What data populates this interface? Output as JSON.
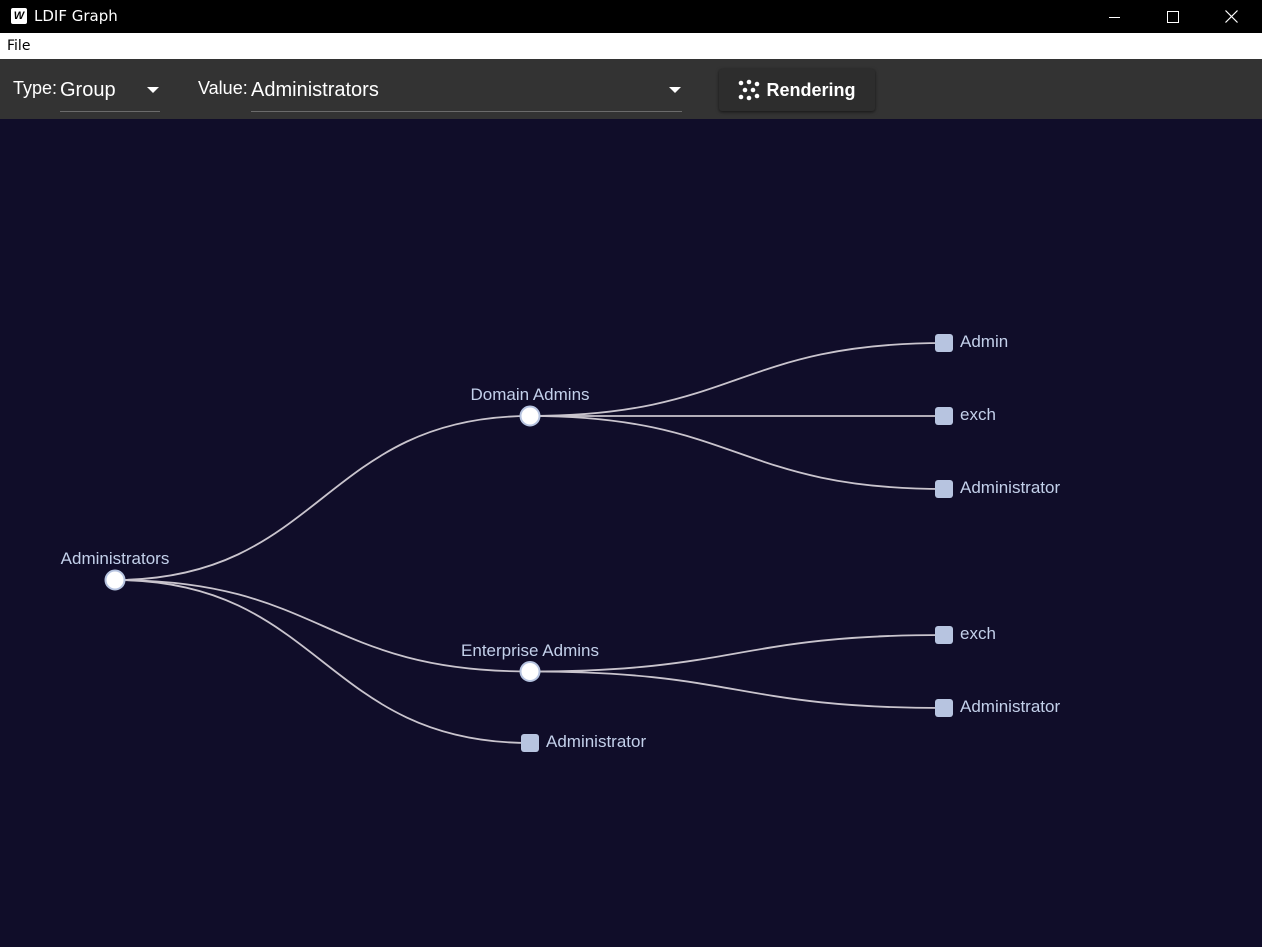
{
  "window": {
    "app_icon_letter": "W",
    "title": "LDIF Graph",
    "controls": [
      "minimize-icon",
      "maximize-icon",
      "close-icon"
    ]
  },
  "menu": {
    "file_label": "File"
  },
  "toolbar": {
    "type_label": "Type:",
    "type_value": "Group",
    "value_label": "Value:",
    "value_value": "Administrators",
    "render_label": "Rendering",
    "render_icon": "graph-nodes-icon"
  },
  "graph": {
    "colors": {
      "background": "#100d29",
      "link": "#c9c4cd",
      "node_fill": "#b7c4e0",
      "group_node_fill": "#ffffff",
      "label": "#c3d0ea"
    },
    "root": {
      "name": "Administrators",
      "kind": "group",
      "children": [
        {
          "name": "Domain Admins",
          "kind": "group",
          "children": [
            {
              "name": "Admin",
              "kind": "user"
            },
            {
              "name": "exch",
              "kind": "user"
            },
            {
              "name": "Administrator",
              "kind": "user"
            }
          ]
        },
        {
          "name": "Enterprise Admins",
          "kind": "group",
          "children": [
            {
              "name": "exch",
              "kind": "user"
            },
            {
              "name": "Administrator",
              "kind": "user"
            }
          ]
        },
        {
          "name": "Administrator",
          "kind": "user"
        }
      ]
    }
  }
}
